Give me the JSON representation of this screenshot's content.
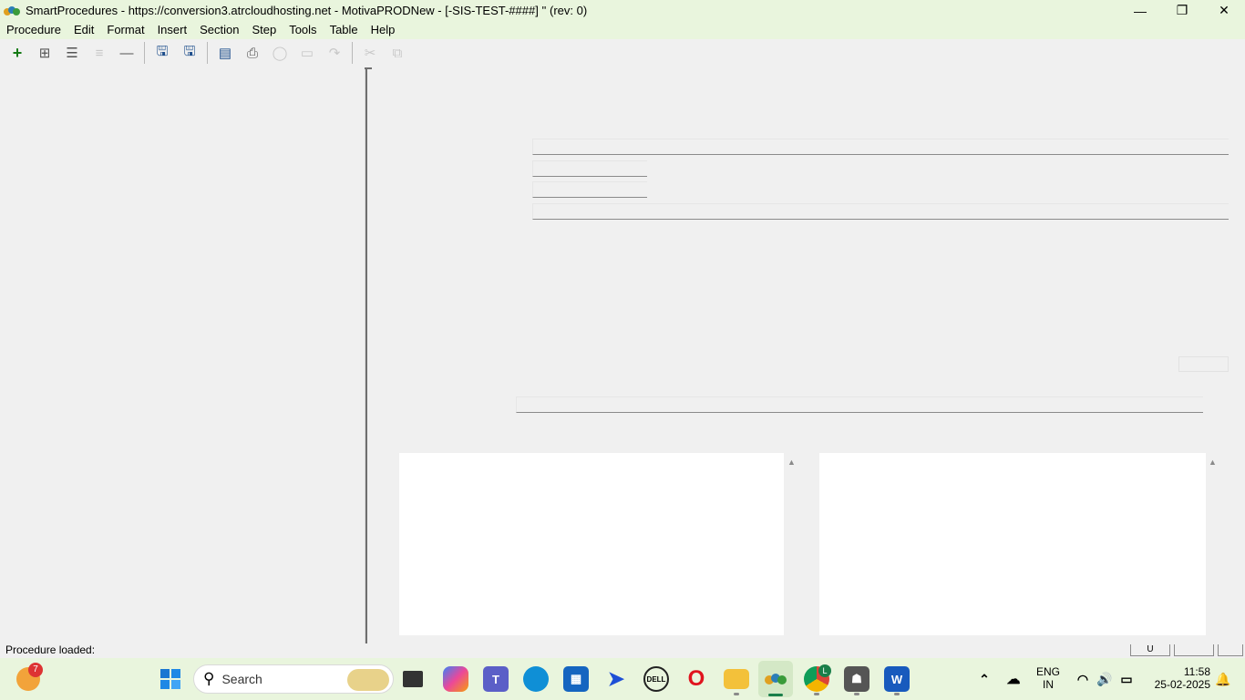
{
  "window": {
    "title": "SmartProcedures - https://conversion3.atrcloudhosting.net - MotivaPRODNew - [-SIS-TEST-####] '' (rev: 0)",
    "controls": {
      "minimize": "—",
      "restore": "❐",
      "close": "✕"
    }
  },
  "menu": [
    "Procedure",
    "Edit",
    "Format",
    "Insert",
    "Section",
    "Step",
    "Tools",
    "Table",
    "Help"
  ],
  "toolbar": {
    "icons": [
      "add-icon",
      "add-child-icon",
      "list-icon",
      "outline-icon",
      "remove-icon",
      "save-as-icon",
      "save-icon",
      "publish-icon",
      "print-icon",
      "refresh-icon",
      "preview-icon",
      "share-icon",
      "cut-icon",
      "copy-icon"
    ]
  },
  "status": {
    "text": "Procedure loaded:",
    "cell1": "U"
  },
  "taskbar": {
    "weather_badge": "7",
    "search_label": "Search",
    "chrome_badge": "L",
    "lang_top": "ENG",
    "lang_bottom": "IN",
    "time": "11:58",
    "date": "25-02-2025"
  },
  "colors": {
    "titlebar_bg": "#e9f5dd",
    "app_bg": "#f0f0f0",
    "panel_bg": "#ffffff"
  }
}
